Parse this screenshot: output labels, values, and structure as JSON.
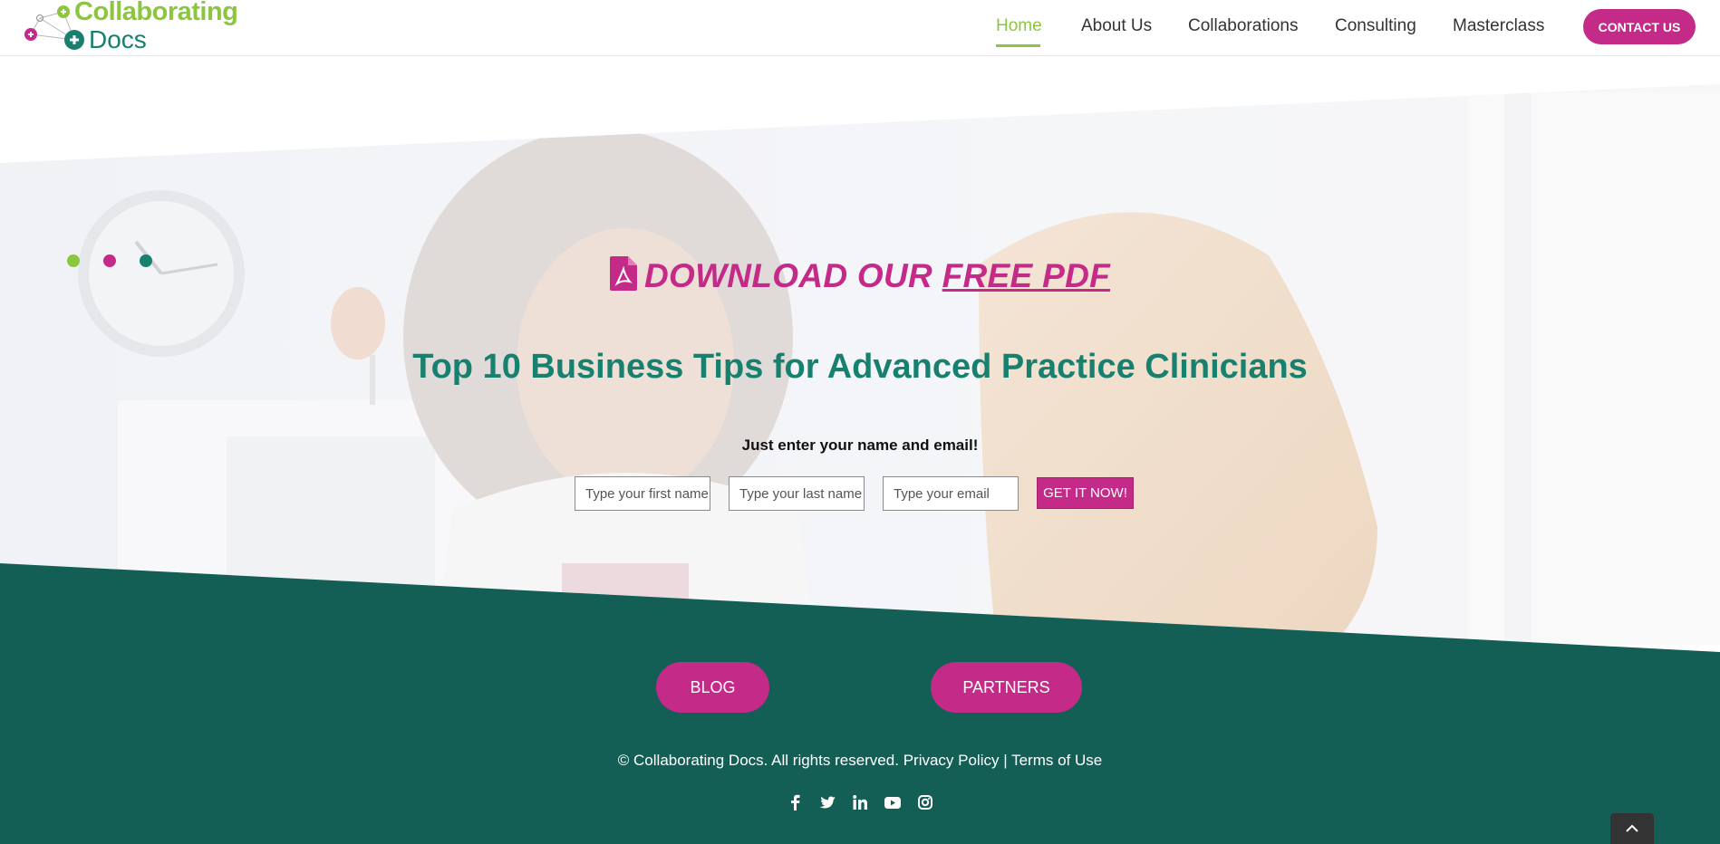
{
  "brand": {
    "line1": "Collaborating",
    "line2": "Docs",
    "colors": {
      "green": "#8cc63f",
      "teal": "#18806f",
      "magenta": "#c42a88",
      "footer": "#135e55"
    }
  },
  "nav": {
    "items": [
      {
        "label": "Home",
        "active": true
      },
      {
        "label": "About Us"
      },
      {
        "label": "Collaborations"
      },
      {
        "label": "Consulting"
      },
      {
        "label": "Masterclass"
      }
    ],
    "contact_label": "CONTACT US"
  },
  "hero": {
    "pdf_prefix": "DOWNLOAD OUR ",
    "pdf_link": "FREE PDF",
    "pdf_icon": "file-pdf-icon",
    "title": "Top 10 Business Tips for Advanced Practice Clinicians",
    "subtitle": "Just enter your name and email!",
    "form": {
      "first_name_placeholder": "Type your first name",
      "last_name_placeholder": "Type your last name",
      "email_placeholder": "Type your email",
      "submit_label": "GET IT NOW!"
    }
  },
  "footer": {
    "blog_label": "BLOG",
    "partners_label": "PARTNERS",
    "copyright": "© Collaborating Docs. All rights reserved.",
    "privacy": "Privacy Policy",
    "separator": "|",
    "terms": "Terms of Use",
    "socials": [
      "facebook-icon",
      "twitter-icon",
      "linkedin-icon",
      "youtube-icon",
      "instagram-icon"
    ],
    "to_top_icon": "chevron-up-icon"
  }
}
